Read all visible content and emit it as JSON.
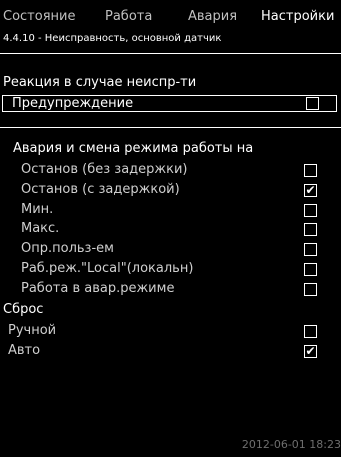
{
  "tabs": [
    "Состояние",
    "Работа",
    "Авария",
    "Настройки"
  ],
  "breadcrumb": "4.4.10 - Неисправность, основной датчик",
  "reaction": {
    "title": "Реакция в случае неиспр-ти",
    "selected_label": "Предупреждение",
    "selected_checked": false
  },
  "alarm": {
    "title": "Авария и смена режима работы на",
    "options": [
      {
        "label": "Останов (без задержки)",
        "checked": false
      },
      {
        "label": "Останов (с задержкой)",
        "checked": true
      },
      {
        "label": "Мин.",
        "checked": false
      },
      {
        "label": "Макс.",
        "checked": false
      },
      {
        "label": "Опр.польз-ем",
        "checked": false
      },
      {
        "label": "Раб.реж.\"Local\"(локальн)",
        "checked": false
      },
      {
        "label": "Работа в авар.режиме",
        "checked": false
      }
    ]
  },
  "reset": {
    "title": "Сброс",
    "options": [
      {
        "label": "Ручной",
        "checked": false
      },
      {
        "label": "Авто",
        "checked": true
      }
    ]
  },
  "status": {
    "datetime": "2012-06-01 18:23"
  }
}
